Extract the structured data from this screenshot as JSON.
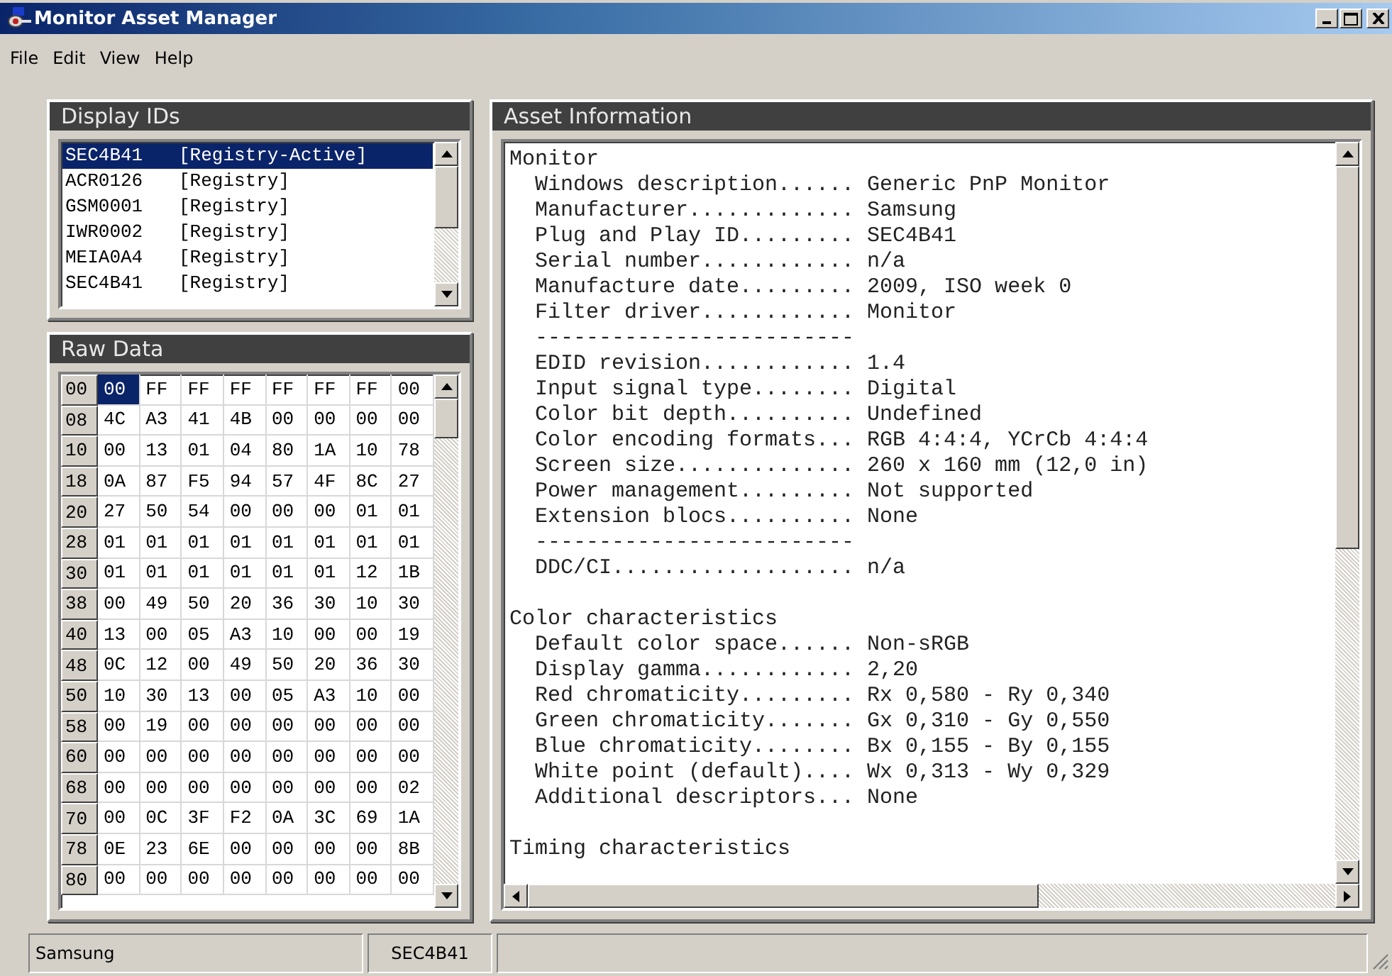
{
  "window": {
    "title": "Monitor Asset Manager"
  },
  "menu": [
    {
      "label": "File"
    },
    {
      "label": "Edit"
    },
    {
      "label": "View"
    },
    {
      "label": "Help"
    }
  ],
  "display_ids": {
    "title": "Display IDs",
    "items": [
      {
        "id": "SEC4B41",
        "source": "[Registry-Active]",
        "selected": true
      },
      {
        "id": "ACR0126",
        "source": "[Registry]",
        "selected": false
      },
      {
        "id": "GSM0001",
        "source": "[Registry]",
        "selected": false
      },
      {
        "id": "IWR0002",
        "source": "[Registry]",
        "selected": false
      },
      {
        "id": "MEIA0A4",
        "source": "[Registry]",
        "selected": false
      },
      {
        "id": "SEC4B41",
        "source": "[Registry]",
        "selected": false
      }
    ]
  },
  "raw_data": {
    "title": "Raw Data",
    "rows": [
      {
        "address": "00",
        "cells": [
          {
            "v": "00",
            "selected": true
          },
          {
            "v": "FF",
            "selected": false
          },
          {
            "v": "FF",
            "selected": false
          },
          {
            "v": "FF",
            "selected": false
          },
          {
            "v": "FF",
            "selected": false
          },
          {
            "v": "FF",
            "selected": false
          },
          {
            "v": "FF",
            "selected": false
          },
          {
            "v": "00",
            "selected": false
          }
        ]
      },
      {
        "address": "08",
        "cells": [
          {
            "v": "4C",
            "selected": false
          },
          {
            "v": "A3",
            "selected": false
          },
          {
            "v": "41",
            "selected": false
          },
          {
            "v": "4B",
            "selected": false
          },
          {
            "v": "00",
            "selected": false
          },
          {
            "v": "00",
            "selected": false
          },
          {
            "v": "00",
            "selected": false
          },
          {
            "v": "00",
            "selected": false
          }
        ]
      },
      {
        "address": "10",
        "cells": [
          {
            "v": "00",
            "selected": false
          },
          {
            "v": "13",
            "selected": false
          },
          {
            "v": "01",
            "selected": false
          },
          {
            "v": "04",
            "selected": false
          },
          {
            "v": "80",
            "selected": false
          },
          {
            "v": "1A",
            "selected": false
          },
          {
            "v": "10",
            "selected": false
          },
          {
            "v": "78",
            "selected": false
          }
        ]
      },
      {
        "address": "18",
        "cells": [
          {
            "v": "0A",
            "selected": false
          },
          {
            "v": "87",
            "selected": false
          },
          {
            "v": "F5",
            "selected": false
          },
          {
            "v": "94",
            "selected": false
          },
          {
            "v": "57",
            "selected": false
          },
          {
            "v": "4F",
            "selected": false
          },
          {
            "v": "8C",
            "selected": false
          },
          {
            "v": "27",
            "selected": false
          }
        ]
      },
      {
        "address": "20",
        "cells": [
          {
            "v": "27",
            "selected": false
          },
          {
            "v": "50",
            "selected": false
          },
          {
            "v": "54",
            "selected": false
          },
          {
            "v": "00",
            "selected": false
          },
          {
            "v": "00",
            "selected": false
          },
          {
            "v": "00",
            "selected": false
          },
          {
            "v": "01",
            "selected": false
          },
          {
            "v": "01",
            "selected": false
          }
        ]
      },
      {
        "address": "28",
        "cells": [
          {
            "v": "01",
            "selected": false
          },
          {
            "v": "01",
            "selected": false
          },
          {
            "v": "01",
            "selected": false
          },
          {
            "v": "01",
            "selected": false
          },
          {
            "v": "01",
            "selected": false
          },
          {
            "v": "01",
            "selected": false
          },
          {
            "v": "01",
            "selected": false
          },
          {
            "v": "01",
            "selected": false
          }
        ]
      },
      {
        "address": "30",
        "cells": [
          {
            "v": "01",
            "selected": false
          },
          {
            "v": "01",
            "selected": false
          },
          {
            "v": "01",
            "selected": false
          },
          {
            "v": "01",
            "selected": false
          },
          {
            "v": "01",
            "selected": false
          },
          {
            "v": "01",
            "selected": false
          },
          {
            "v": "12",
            "selected": false
          },
          {
            "v": "1B",
            "selected": false
          }
        ]
      },
      {
        "address": "38",
        "cells": [
          {
            "v": "00",
            "selected": false
          },
          {
            "v": "49",
            "selected": false
          },
          {
            "v": "50",
            "selected": false
          },
          {
            "v": "20",
            "selected": false
          },
          {
            "v": "36",
            "selected": false
          },
          {
            "v": "30",
            "selected": false
          },
          {
            "v": "10",
            "selected": false
          },
          {
            "v": "30",
            "selected": false
          }
        ]
      },
      {
        "address": "40",
        "cells": [
          {
            "v": "13",
            "selected": false
          },
          {
            "v": "00",
            "selected": false
          },
          {
            "v": "05",
            "selected": false
          },
          {
            "v": "A3",
            "selected": false
          },
          {
            "v": "10",
            "selected": false
          },
          {
            "v": "00",
            "selected": false
          },
          {
            "v": "00",
            "selected": false
          },
          {
            "v": "19",
            "selected": false
          }
        ]
      },
      {
        "address": "48",
        "cells": [
          {
            "v": "0C",
            "selected": false
          },
          {
            "v": "12",
            "selected": false
          },
          {
            "v": "00",
            "selected": false
          },
          {
            "v": "49",
            "selected": false
          },
          {
            "v": "50",
            "selected": false
          },
          {
            "v": "20",
            "selected": false
          },
          {
            "v": "36",
            "selected": false
          },
          {
            "v": "30",
            "selected": false
          }
        ]
      },
      {
        "address": "50",
        "cells": [
          {
            "v": "10",
            "selected": false
          },
          {
            "v": "30",
            "selected": false
          },
          {
            "v": "13",
            "selected": false
          },
          {
            "v": "00",
            "selected": false
          },
          {
            "v": "05",
            "selected": false
          },
          {
            "v": "A3",
            "selected": false
          },
          {
            "v": "10",
            "selected": false
          },
          {
            "v": "00",
            "selected": false
          }
        ]
      },
      {
        "address": "58",
        "cells": [
          {
            "v": "00",
            "selected": false
          },
          {
            "v": "19",
            "selected": false
          },
          {
            "v": "00",
            "selected": false
          },
          {
            "v": "00",
            "selected": false
          },
          {
            "v": "00",
            "selected": false
          },
          {
            "v": "00",
            "selected": false
          },
          {
            "v": "00",
            "selected": false
          },
          {
            "v": "00",
            "selected": false
          }
        ]
      },
      {
        "address": "60",
        "cells": [
          {
            "v": "00",
            "selected": false
          },
          {
            "v": "00",
            "selected": false
          },
          {
            "v": "00",
            "selected": false
          },
          {
            "v": "00",
            "selected": false
          },
          {
            "v": "00",
            "selected": false
          },
          {
            "v": "00",
            "selected": false
          },
          {
            "v": "00",
            "selected": false
          },
          {
            "v": "00",
            "selected": false
          }
        ]
      },
      {
        "address": "68",
        "cells": [
          {
            "v": "00",
            "selected": false
          },
          {
            "v": "00",
            "selected": false
          },
          {
            "v": "00",
            "selected": false
          },
          {
            "v": "00",
            "selected": false
          },
          {
            "v": "00",
            "selected": false
          },
          {
            "v": "00",
            "selected": false
          },
          {
            "v": "00",
            "selected": false
          },
          {
            "v": "02",
            "selected": false
          }
        ]
      },
      {
        "address": "70",
        "cells": [
          {
            "v": "00",
            "selected": false
          },
          {
            "v": "0C",
            "selected": false
          },
          {
            "v": "3F",
            "selected": false
          },
          {
            "v": "F2",
            "selected": false
          },
          {
            "v": "0A",
            "selected": false
          },
          {
            "v": "3C",
            "selected": false
          },
          {
            "v": "69",
            "selected": false
          },
          {
            "v": "1A",
            "selected": false
          }
        ]
      },
      {
        "address": "78",
        "cells": [
          {
            "v": "0E",
            "selected": false
          },
          {
            "v": "23",
            "selected": false
          },
          {
            "v": "6E",
            "selected": false
          },
          {
            "v": "00",
            "selected": false
          },
          {
            "v": "00",
            "selected": false
          },
          {
            "v": "00",
            "selected": false
          },
          {
            "v": "00",
            "selected": false
          },
          {
            "v": "8B",
            "selected": false
          }
        ]
      },
      {
        "address": "80",
        "cells": [
          {
            "v": "00",
            "selected": false
          },
          {
            "v": "00",
            "selected": false
          },
          {
            "v": "00",
            "selected": false
          },
          {
            "v": "00",
            "selected": false
          },
          {
            "v": "00",
            "selected": false
          },
          {
            "v": "00",
            "selected": false
          },
          {
            "v": "00",
            "selected": false
          },
          {
            "v": "00",
            "selected": false
          }
        ]
      }
    ]
  },
  "asset_information": {
    "title": "Asset Information",
    "lines": [
      {
        "kind": "heading",
        "text": "Monitor"
      },
      {
        "kind": "field",
        "label": "Windows description......",
        "value": "Generic PnP Monitor"
      },
      {
        "kind": "field",
        "label": "Manufacturer.............",
        "value": "Samsung"
      },
      {
        "kind": "field",
        "label": "Plug and Play ID.........",
        "value": "SEC4B41"
      },
      {
        "kind": "field",
        "label": "Serial number............",
        "value": "n/a"
      },
      {
        "kind": "field",
        "label": "Manufacture date.........",
        "value": "2009, ISO week 0"
      },
      {
        "kind": "field",
        "label": "Filter driver............",
        "value": "Monitor"
      },
      {
        "kind": "rule",
        "text": "-------------------------"
      },
      {
        "kind": "field",
        "label": "EDID revision............",
        "value": "1.4"
      },
      {
        "kind": "field",
        "label": "Input signal type........",
        "value": "Digital"
      },
      {
        "kind": "field",
        "label": "Color bit depth..........",
        "value": "Undefined"
      },
      {
        "kind": "field",
        "label": "Color encoding formats...",
        "value": "RGB 4:4:4, YCrCb 4:4:4"
      },
      {
        "kind": "field",
        "label": "Screen size..............",
        "value": "260 x 160 mm (12,0 in)"
      },
      {
        "kind": "field",
        "label": "Power management.........",
        "value": "Not supported"
      },
      {
        "kind": "field",
        "label": "Extension blocs..........",
        "value": "None"
      },
      {
        "kind": "rule",
        "text": "-------------------------"
      },
      {
        "kind": "field",
        "label": "DDC/CI...................",
        "value": "n/a"
      },
      {
        "kind": "blank"
      },
      {
        "kind": "heading",
        "text": "Color characteristics"
      },
      {
        "kind": "field",
        "label": "Default color space......",
        "value": "Non-sRGB"
      },
      {
        "kind": "field",
        "label": "Display gamma............",
        "value": "2,20"
      },
      {
        "kind": "field",
        "label": "Red chromaticity.........",
        "value": "Rx 0,580 - Ry 0,340"
      },
      {
        "kind": "field",
        "label": "Green chromaticity.......",
        "value": "Gx 0,310 - Gy 0,550"
      },
      {
        "kind": "field",
        "label": "Blue chromaticity........",
        "value": "Bx 0,155 - By 0,155"
      },
      {
        "kind": "field",
        "label": "White point (default)....",
        "value": "Wx 0,313 - Wy 0,329"
      },
      {
        "kind": "field",
        "label": "Additional descriptors...",
        "value": "None"
      },
      {
        "kind": "blank"
      },
      {
        "kind": "heading",
        "text": "Timing characteristics"
      }
    ]
  },
  "status_bar": [
    "Samsung",
    "SEC4B41"
  ]
}
